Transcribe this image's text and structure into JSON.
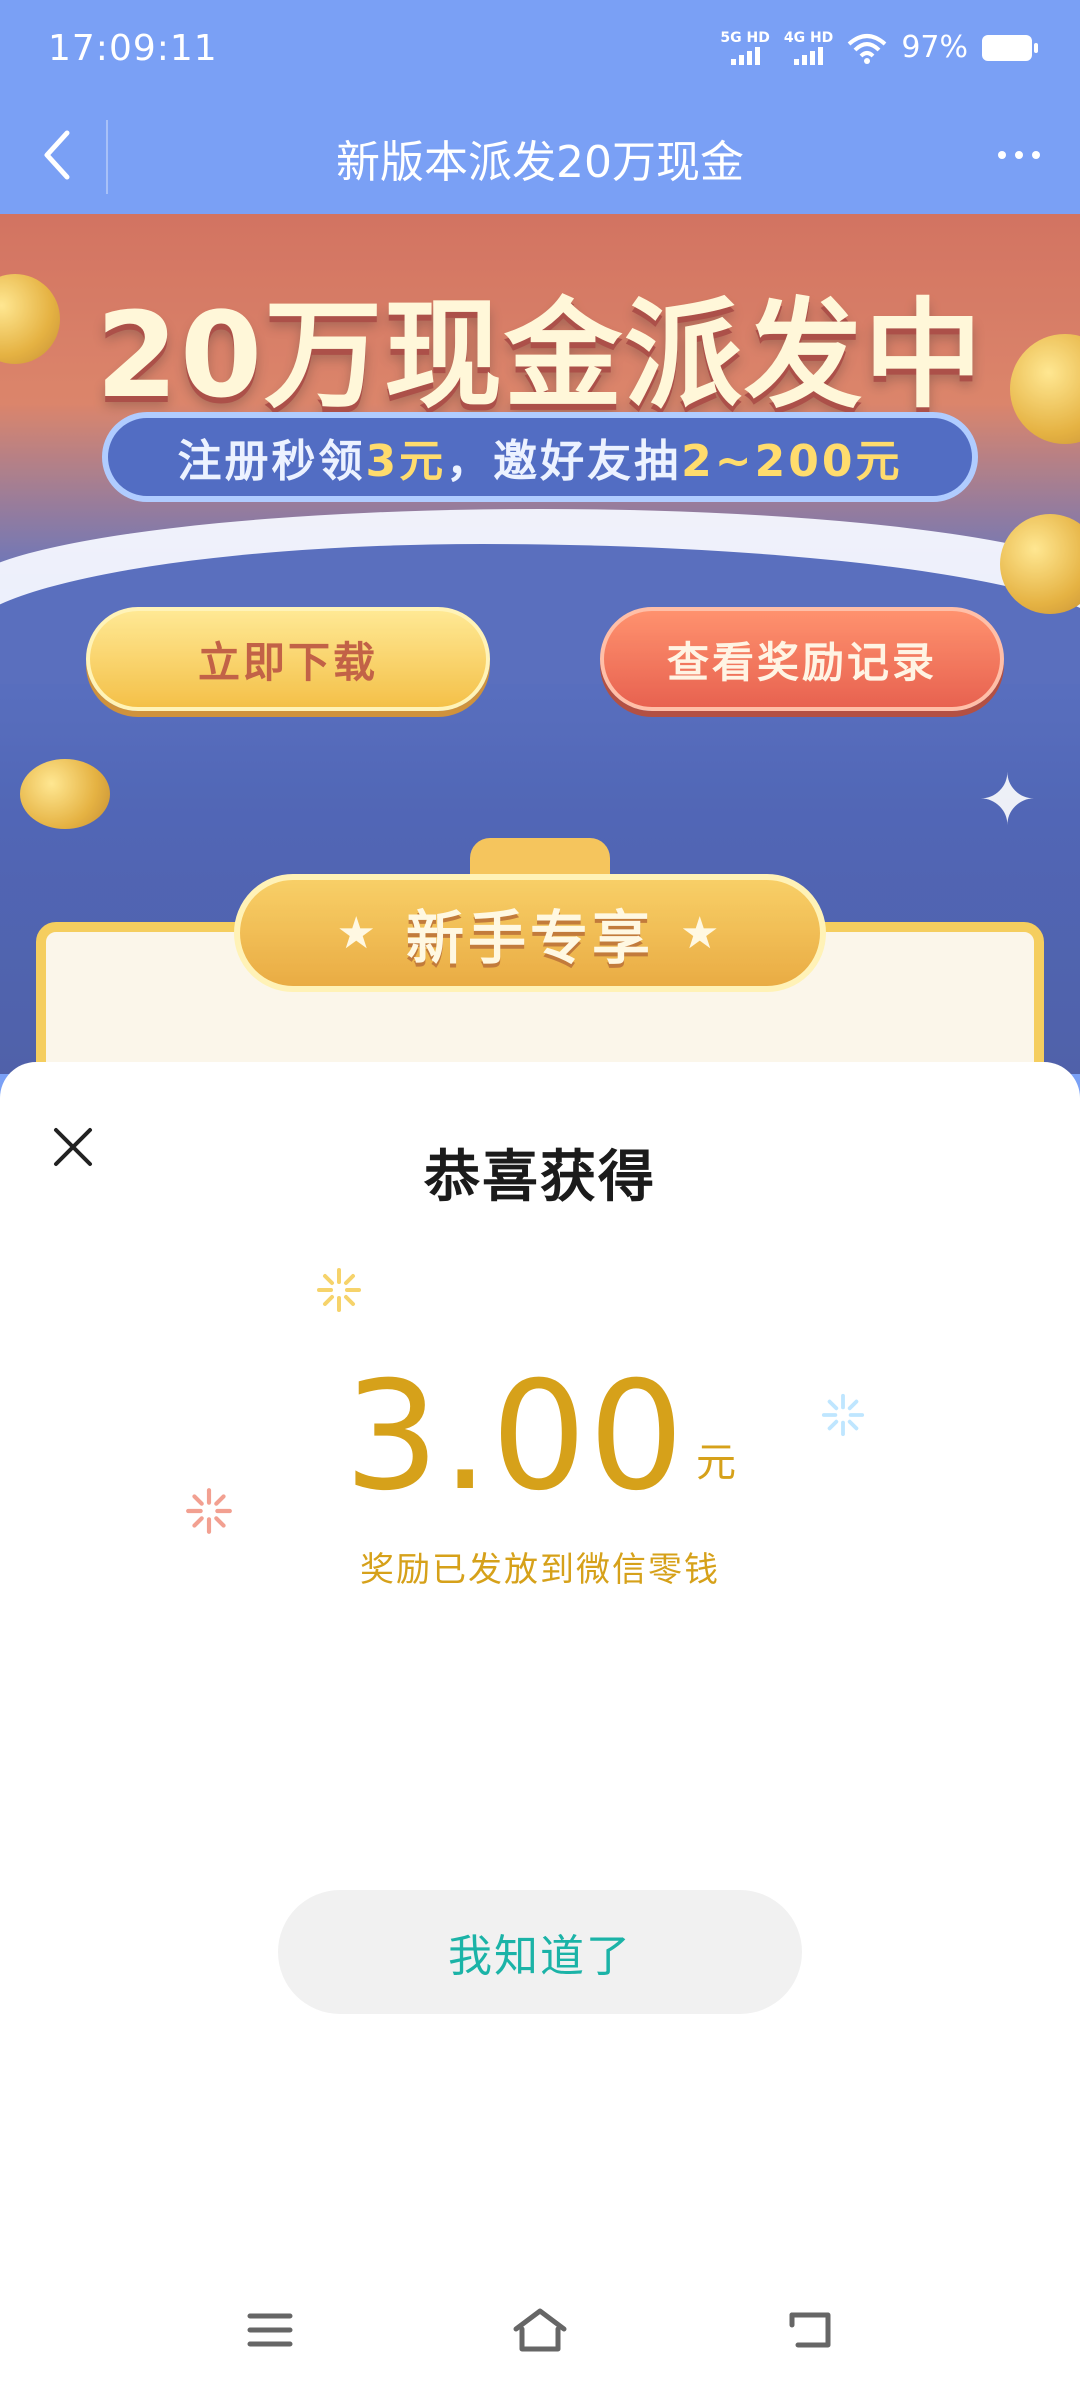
{
  "status_bar": {
    "time": "17:09:11",
    "network_1": "5G HD",
    "network_2": "4G HD",
    "battery": "97%"
  },
  "title_bar": {
    "title": "新版本派发20万现金",
    "icons": {
      "back": "chevron-left-icon",
      "more": "more-dots-icon"
    }
  },
  "banner": {
    "headline": "20万现金派发中",
    "subtitle_prefix": "注册秒领",
    "subtitle_amount": "3元",
    "subtitle_mid": "，邀好友抽",
    "subtitle_range": "2~200元",
    "download_button": "立即下载",
    "records_button": "查看奖励记录",
    "newbie_badge": "新手专享"
  },
  "sheet": {
    "title": "恭喜获得",
    "amount": "3.00",
    "unit": "元",
    "note": "奖励已发放到微信零钱",
    "confirm_button": "我知道了",
    "close_icon": "close-icon"
  },
  "nav_bar": {
    "icons": [
      "menu-icon",
      "home-icon",
      "back-icon"
    ]
  },
  "colors": {
    "header_blue": "#7aa0f5",
    "amount_gold": "#d6a11a",
    "confirm_teal": "#1bb3a7"
  }
}
